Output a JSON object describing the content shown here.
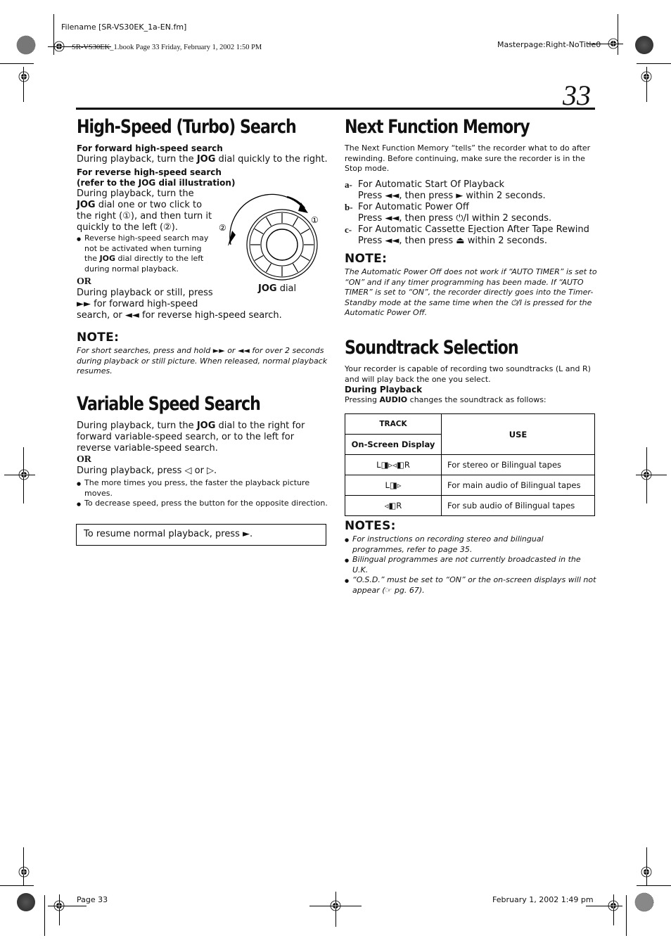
{
  "header": {
    "filename": "Filename [SR-VS30EK_1a-EN.fm]",
    "book_info": "SR-VS30EK_1.book  Page 33  Friday, February 1, 2002  1:50 PM",
    "masterpage": "Masterpage:Right-NoTitle0",
    "page_number": "33"
  },
  "left": {
    "turbo": {
      "title": "High-Speed (Turbo) Search",
      "forward_heading": "For forward high-speed search",
      "forward_text_a": "During playback, turn the ",
      "forward_text_bold": "JOG",
      "forward_text_b": " dial quickly to the right.",
      "reverse_heading_1": "For reverse high-speed search",
      "reverse_heading_2": "(refer to the JOG dial illustration)",
      "reverse_line1": "During playback, turn the",
      "reverse_bold": "JOG",
      "reverse_line2": " dial one or two click to",
      "reverse_line3": "the right (①), and then turn it",
      "reverse_line4": "quickly to the left (②).",
      "bullet_1": "Reverse high-speed search may",
      "bullet_2": "not be activated when turning",
      "bullet_3a": "the ",
      "bullet_3bold": "JOG",
      "bullet_3b": " dial directly to the left",
      "bullet_4": "during normal playback.",
      "or": "OR",
      "or_line1": "During playback or still, press",
      "or_line2": "►► for forward high-speed",
      "or_line3": "search, or ◄◄ for reverse high-speed search.",
      "dial_label_bold": "JOG",
      "dial_label": " dial",
      "dial_mark_1": "①",
      "dial_mark_2": "②"
    },
    "turbo_note": {
      "heading": "NOTE:",
      "text": "For short searches, press and hold ►► or ◄◄ for over 2 seconds during playback or still picture. When released, normal playback resumes."
    },
    "variable": {
      "title": "Variable Speed Search",
      "text_a": "During playback, turn the ",
      "text_bold": "JOG",
      "text_b": " dial to the right for forward variable-speed search, or to the left for reverse variable-speed search.",
      "or": "OR",
      "press_text": "During playback, press ◁ or ▷.",
      "bullets": [
        "The more times you press, the faster the playback picture moves.",
        "To decrease speed, press the button for the opposite direction."
      ],
      "resume_box": "To resume normal playback, press ►."
    }
  },
  "right": {
    "memory": {
      "title": "Next Function Memory",
      "intro": "The Next Function Memory “tells” the recorder what to do after rewinding. Before continuing, make sure the recorder is in the Stop mode.",
      "items": [
        {
          "label": "a-",
          "title": "For Automatic Start Of Playback",
          "action": "Press ◄◄, then press ► within 2 seconds."
        },
        {
          "label": "b-",
          "title": "For Automatic Power Off",
          "action": "Press ◄◄, then press ⏻/I within 2 seconds."
        },
        {
          "label": "c-",
          "title": "For Automatic Cassette Ejection After Tape Rewind",
          "action": "Press ◄◄, then press ⏏ within 2 seconds."
        }
      ]
    },
    "memory_note": {
      "heading": "NOTE:",
      "text": "The Automatic Power Off does not work if “AUTO TIMER” is set to “ON” and if any timer programming has been made. If “AUTO TIMER” is set to “ON”, the recorder directly goes into the Timer-Standby mode at the same time when the ⏻/I is pressed for the Automatic Power Off."
    },
    "soundtrack": {
      "title": "Soundtrack Selection",
      "intro": "Your recorder is capable of recording two soundtracks (L and R) and will play back the one you select.",
      "during": "During Playback",
      "press_a": "Pressing ",
      "press_bold": "AUDIO",
      "press_b": " changes the soundtrack as follows:",
      "table": {
        "header_track": "TRACK",
        "header_display": "On-Screen Display",
        "header_use": "USE",
        "rows": [
          {
            "display": "L◨▹◃◧R",
            "use": "For stereo or Bilingual tapes"
          },
          {
            "display": "L◨▹",
            "use": "For main audio of Bilingual tapes"
          },
          {
            "display": "◃◧R",
            "use": "For sub audio of Bilingual tapes"
          }
        ]
      }
    },
    "notes": {
      "heading": "NOTES:",
      "items": [
        "For instructions on recording stereo and bilingual programmes, refer to page 35.",
        "Bilingual programmes are not currently broadcasted in the U.K.",
        "“O.S.D.” must be set to “ON” or the on-screen displays will not appear (☞ pg. 67)."
      ]
    }
  },
  "footer": {
    "page_label": "Page 33",
    "date": "February 1, 2002 1:49 pm"
  }
}
